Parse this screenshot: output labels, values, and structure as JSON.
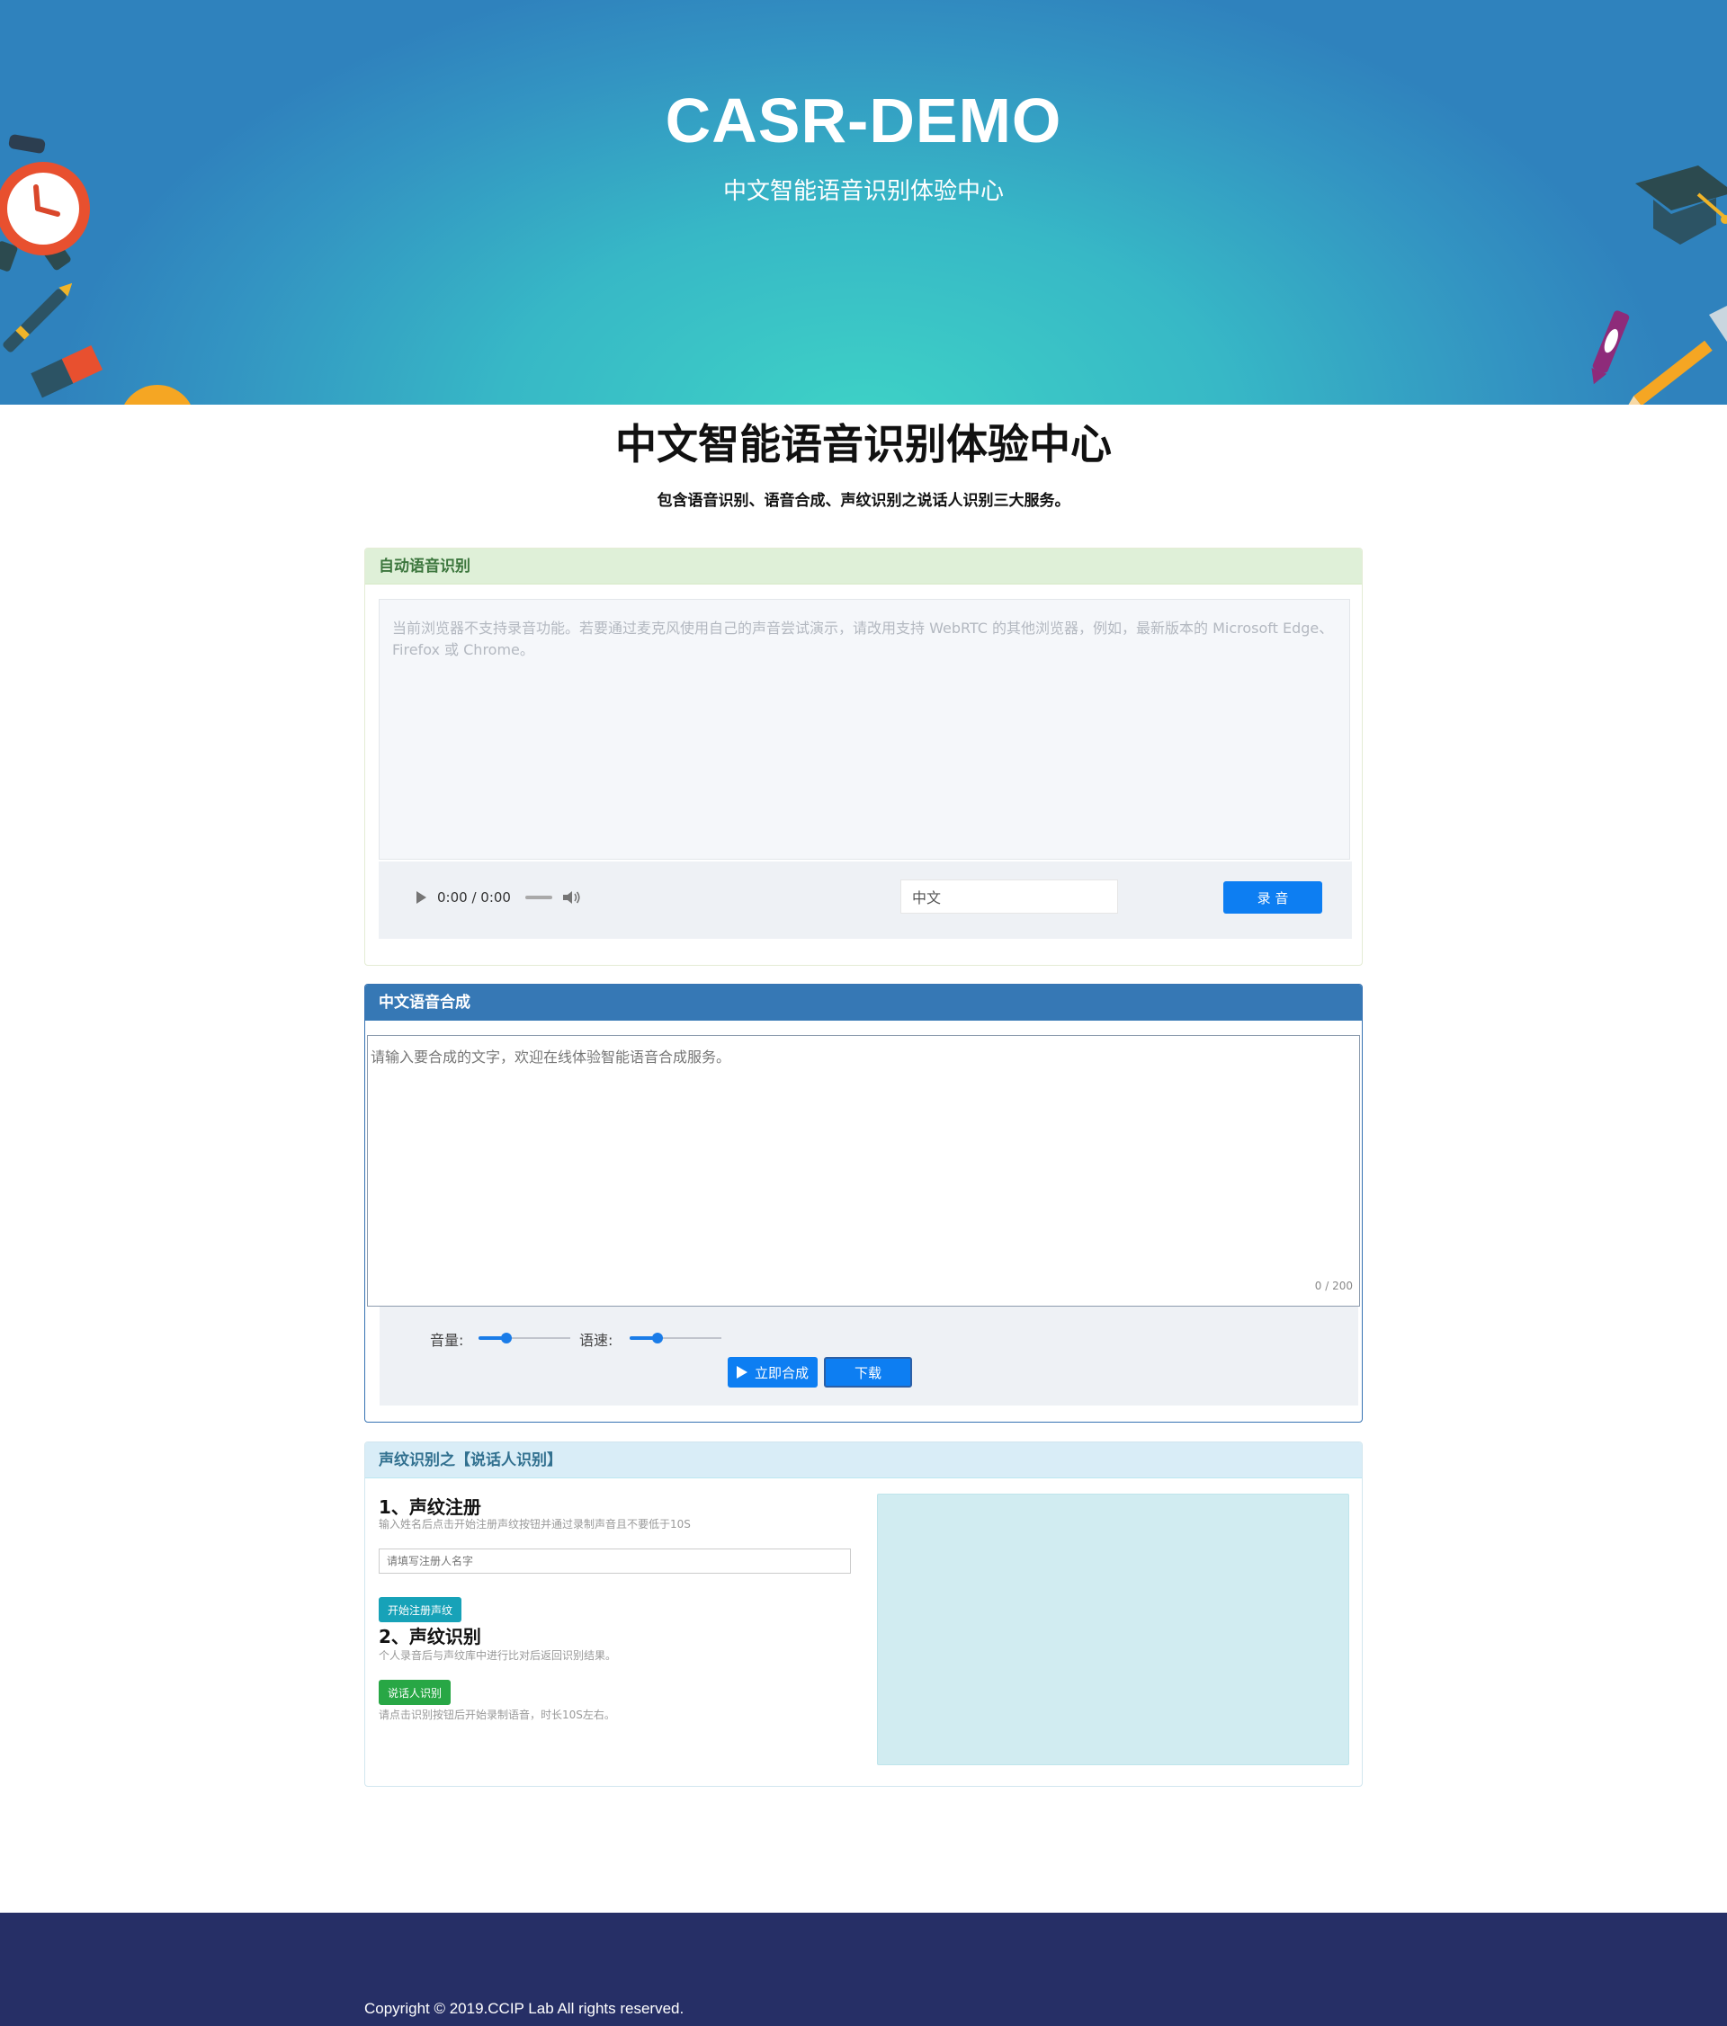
{
  "banner": {
    "title": "CASR-DEMO",
    "subtitle": "中文智能语音识别体验中心"
  },
  "main": {
    "title": "中文智能语音识别体验中心",
    "description": "包含语音识别、语音合成、声纹识别之说话人识别三大服务。"
  },
  "asr": {
    "heading": "自动语音识别",
    "notice": "当前浏览器不支持录音功能。若要通过麦克风使用自己的声音尝试演示，请改用支持 WebRTC 的其他浏览器，例如，最新版本的 Microsoft Edge、Firefox 或 Chrome。",
    "player_time": "0:00 / 0:00",
    "language_value": "中文",
    "record_label": "录 音"
  },
  "tts": {
    "heading": "中文语音合成",
    "placeholder": "请输入要合成的文字，欢迎在线体验智能语音合成服务。",
    "counter": "0 / 200",
    "volume_label": "音量:",
    "speed_label": "语速:",
    "volume_level": 0.3,
    "speed_level": 0.3,
    "synth_label": "立即合成",
    "download_label": "下载"
  },
  "voiceprint": {
    "heading": "声纹识别之【说话人识别】",
    "register_title": "1、声纹注册",
    "register_note": "输入姓名后点击开始注册声纹按钮并通过录制声音且不要低于10S",
    "name_placeholder": "请填写注册人名字",
    "register_button": "开始注册声纹",
    "identify_title": "2、声纹识别",
    "identify_note": "个人录音后与声纹库中进行比对后返回识别结果。",
    "identify_button": "说话人识别",
    "identify_hint": "请点击识别按钮后开始录制语音，时长10S左右。"
  },
  "footer": {
    "copyright": "Copyright © 2019.CCIP Lab All rights reserved."
  },
  "colors": {
    "banner_center": "#3ed2c6",
    "banner_edge": "#2f82bd",
    "primary_button": "#0d7ef2",
    "info_button": "#17a2b8",
    "success_button": "#28a745",
    "footer_bg": "#262f66"
  }
}
